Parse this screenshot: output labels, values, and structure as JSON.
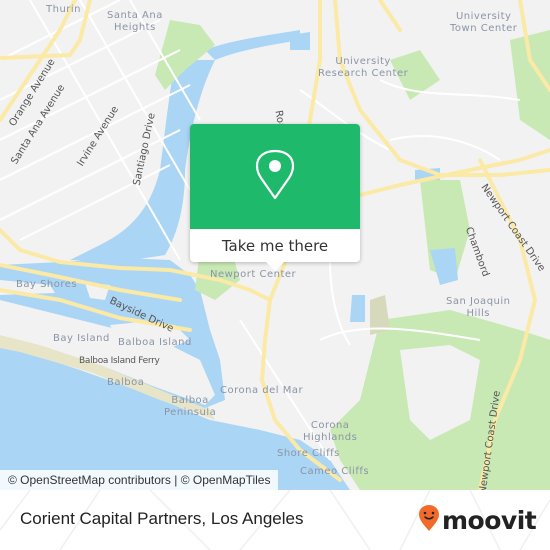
{
  "map": {
    "colors": {
      "land": "#f2f2f2",
      "water": "#aad5f4",
      "park": "#c9e9b4",
      "major_road": "#fbe9a6",
      "minor_road": "#ffffff",
      "sand": "#e8e4c8"
    },
    "place_labels": [
      {
        "text": "Thurin"
      },
      {
        "text": "Santa Ana\nHeights"
      },
      {
        "text": "University\nTown Center"
      },
      {
        "text": "University\nResearch Center"
      },
      {
        "text": "Newport Center"
      },
      {
        "text": "Bay Shores"
      },
      {
        "text": "Bay Island"
      },
      {
        "text": "Balboa Island"
      },
      {
        "text": "Balboa"
      },
      {
        "text": "Balboa\nPeninsula"
      },
      {
        "text": "Corona del Mar"
      },
      {
        "text": "San Joaquin\nHills"
      },
      {
        "text": "Corona\nHighlands"
      },
      {
        "text": "Shore Cliffs"
      },
      {
        "text": "Cameo Cliffs"
      }
    ],
    "road_labels": [
      {
        "text": "Orange Avenue"
      },
      {
        "text": "Santa Ana Avenue"
      },
      {
        "text": "Irvine Avenue"
      },
      {
        "text": "Santiago Drive"
      },
      {
        "text": "Bayside Drive"
      },
      {
        "text": "Newport Coast Drive"
      },
      {
        "text": "Newport Coast Drive"
      },
      {
        "text": "Chambord"
      },
      {
        "text": "Road"
      }
    ],
    "ferry_label": "Balboa Island Ferry",
    "attribution": "© OpenStreetMap contributors | © OpenMapTiles"
  },
  "popup": {
    "icon": "map-pin-icon",
    "button_label": "Take me there",
    "accent_color": "#1fb96b"
  },
  "footer": {
    "title": "Corient Capital Partners, Los Angeles",
    "brand": "moovit",
    "brand_color": "#f26a2a"
  }
}
